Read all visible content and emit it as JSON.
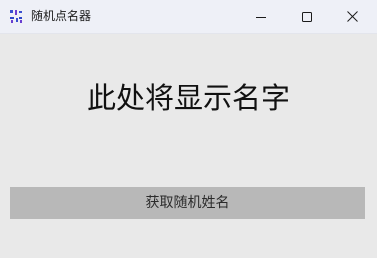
{
  "window": {
    "title": "随机点名器",
    "app_icon": "pinyin-app-icon",
    "controls": {
      "minimize_icon": "minimize-icon",
      "maximize_icon": "maximize-icon",
      "close_icon": "close-icon"
    }
  },
  "main": {
    "name_display": "此处将显示名字",
    "button_label": "获取随机姓名"
  },
  "colors": {
    "titlebar_bg": "#eef0f7",
    "client_bg": "#e9e9e9",
    "button_bg": "#b8b8b8",
    "text": "#111111"
  }
}
